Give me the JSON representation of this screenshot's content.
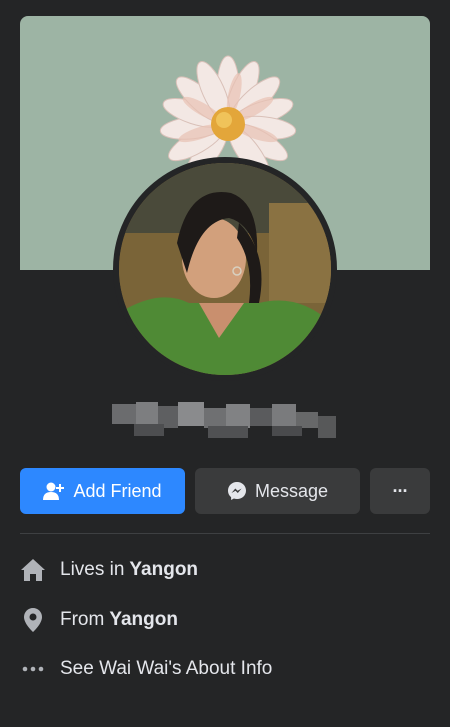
{
  "profile": {
    "add_friend_label": "Add Friend",
    "message_label": "Message",
    "more_label": "···"
  },
  "info": {
    "lives_prefix": "Lives in",
    "lives_city": "Yangon",
    "from_prefix": "From",
    "from_city": "Yangon",
    "about_label": "See Wai Wai's About Info"
  },
  "icons": {
    "add_friend": "person-plus-icon",
    "message": "messenger-icon",
    "more": "ellipsis-icon",
    "home": "home-icon",
    "location": "location-pin-icon",
    "about": "ellipsis-icon"
  },
  "colors": {
    "background": "#242526",
    "primary_button": "#2d88ff",
    "secondary_button": "#3a3b3c",
    "cover": "#9db4a4"
  }
}
